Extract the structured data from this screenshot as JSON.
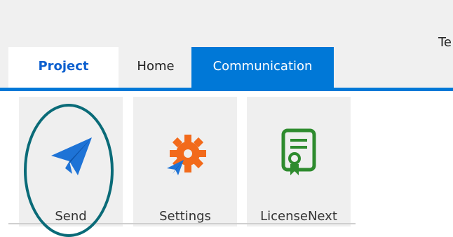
{
  "window": {
    "title_fragment": "Te"
  },
  "tabs": [
    {
      "label": "Project"
    },
    {
      "label": "Home"
    },
    {
      "label": "Communication"
    }
  ],
  "ribbon": {
    "buttons": [
      {
        "label": "Send",
        "icon": "send-paper-plane-icon"
      },
      {
        "label": "Settings",
        "icon": "settings-gear-plane-icon"
      },
      {
        "label": "LicenseNext",
        "icon": "license-certificate-icon"
      }
    ]
  },
  "colors": {
    "accent": "#0078d7",
    "project_tab_text": "#0b5fcf",
    "highlight": "#0a6b78",
    "settings_gear": "#f26a1b",
    "license_green": "#2e8b2e"
  }
}
